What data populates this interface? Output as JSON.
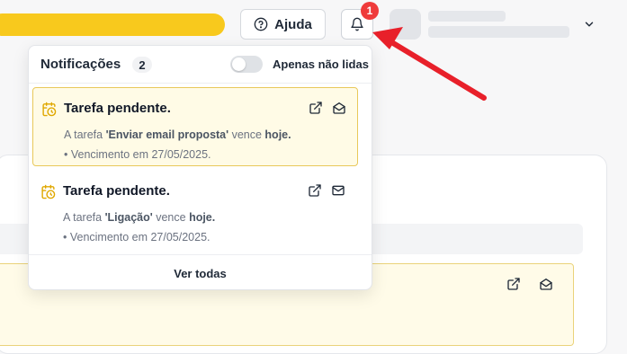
{
  "header": {
    "help_label": "Ajuda",
    "notification_badge": "1"
  },
  "notifications_panel": {
    "title": "Notificações",
    "count": "2",
    "unread_only_label": "Apenas não lidas",
    "unread_only_enabled": false,
    "footer_label": "Ver todas",
    "items": [
      {
        "title": "Tarefa pendente.",
        "text_prefix": "A tarefa ",
        "task": "'Enviar email proposta'",
        "text_middle": " vence ",
        "when": "hoje.",
        "due": "• Vencimento em 27/05/2025.",
        "unread": true
      },
      {
        "title": "Tarefa pendente.",
        "text_prefix": "A tarefa ",
        "task": "'Ligação'",
        "text_middle": " vence ",
        "when": "hoje.",
        "due": "• Vencimento em 27/05/2025.",
        "unread": false
      }
    ]
  },
  "icons": {
    "help": "help-circle-icon",
    "bell": "bell-icon",
    "task": "calendar-clock-icon",
    "open": "external-link-icon",
    "mark_read": "envelope-open-icon",
    "mark_unread": "envelope-icon",
    "user_menu": "chevron-down-icon"
  },
  "colors": {
    "brand_yellow": "#f8c91d",
    "badge_red": "#ef3b3b",
    "arrow_red": "#e8202a",
    "unread_bg": "#fffbe6",
    "unread_border": "#e8c85a",
    "task_icon": "#e0a800"
  }
}
